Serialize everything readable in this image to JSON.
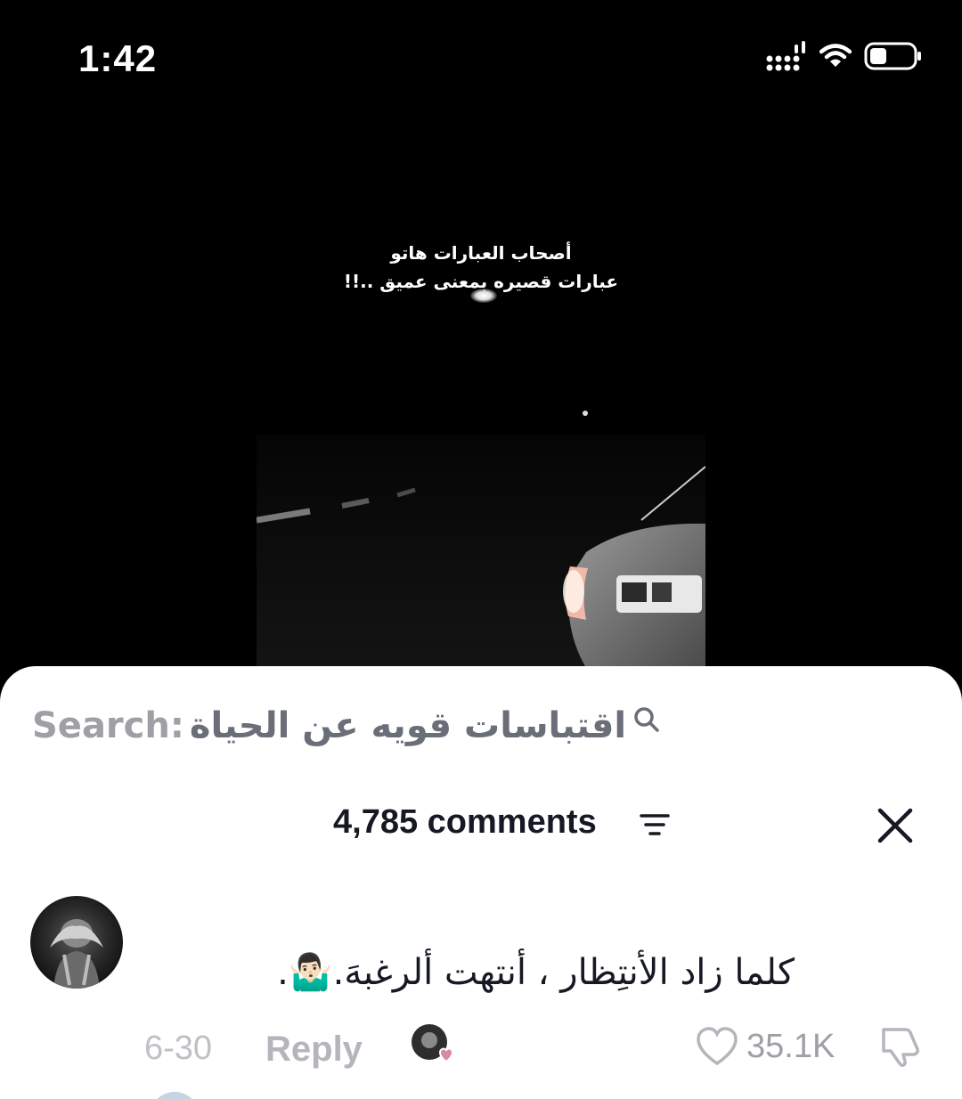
{
  "status_bar": {
    "time": "1:42",
    "icons": [
      "signal-icon",
      "wifi-icon",
      "battery-icon"
    ]
  },
  "video": {
    "overlay_line1": "أصحاب العبارات هاتو",
    "overlay_line2": "عبارات قصيره بمعنى عميق ..!!"
  },
  "search": {
    "label": "Search:",
    "query": "اقتباسات قويه عن الحياة",
    "icon": "search-icon"
  },
  "comments": {
    "count_label": "4,785 comments",
    "filter_icon": "filter-icon",
    "close_icon": "close-icon"
  },
  "comment": {
    "text": "كلما زاد الأنتِظار ، أنتهت ألرغبهَ.🤷🏻‍♂️.",
    "date": "6-30",
    "reply_label": "Reply",
    "likes": "35.1K"
  },
  "colors": {
    "sheet_bg": "#ffffff",
    "primary_text": "#161823",
    "muted_text": "#9ea0a6",
    "liked_heart": "#d88aa0"
  }
}
